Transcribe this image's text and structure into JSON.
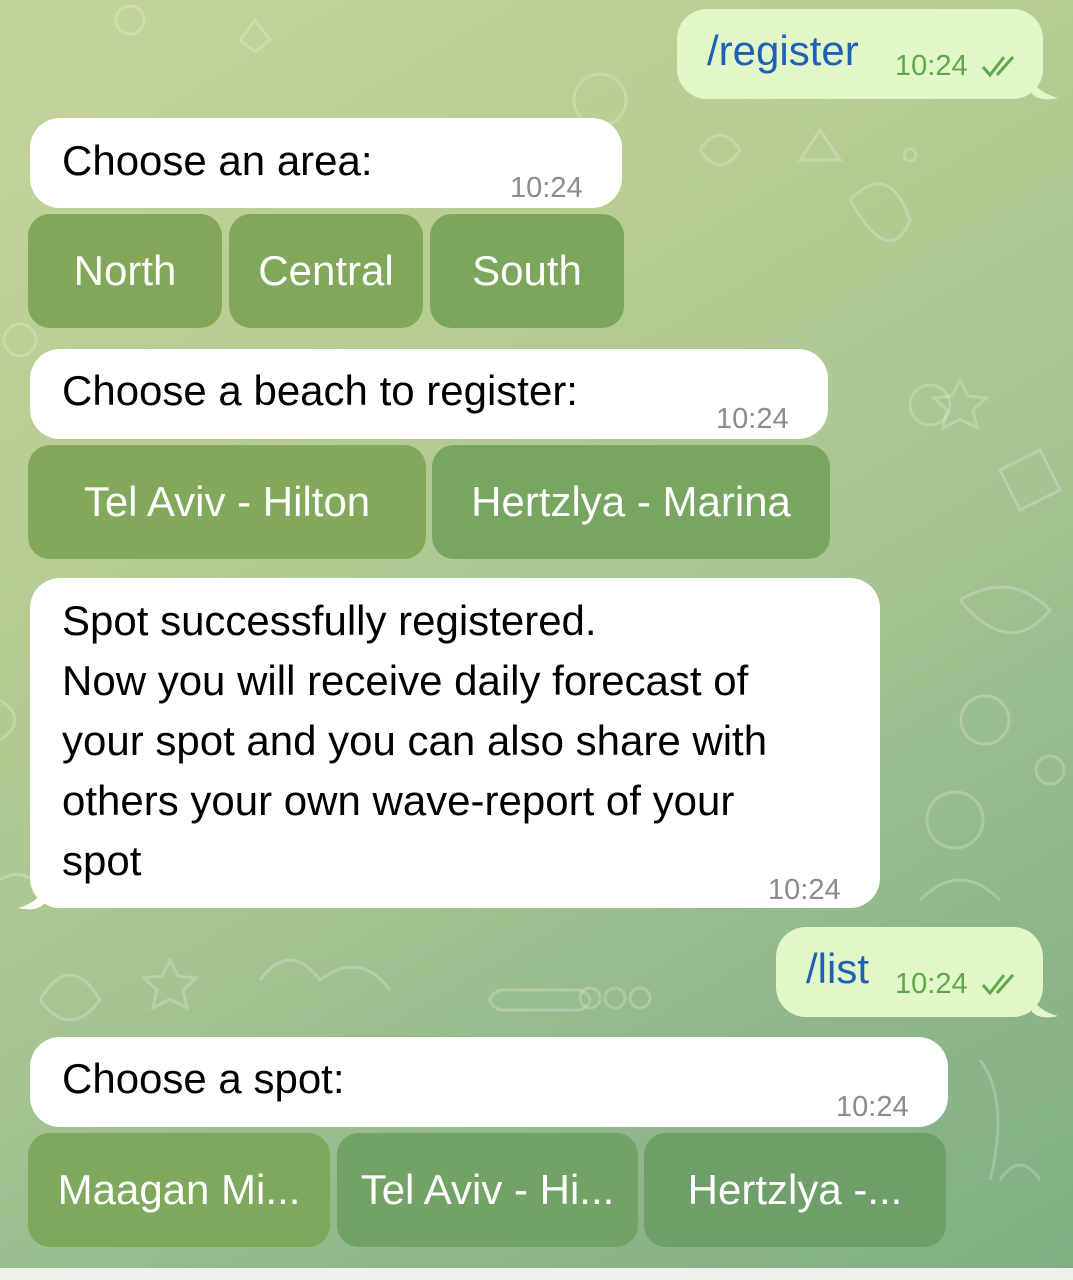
{
  "colors": {
    "incoming_bubble": "#ffffff",
    "outgoing_bubble": "#e2f7c7",
    "command_text": "#1f5fb5",
    "read_checks": "#5fa64f",
    "keyboard_button": "#80a75a"
  },
  "messages": [
    {
      "id": "m1",
      "direction": "outgoing",
      "text": "/register",
      "time": "10:24",
      "status_icon": "double-check-icon"
    },
    {
      "id": "m2",
      "direction": "incoming",
      "text": "Choose an area:",
      "time": "10:24",
      "buttons": [
        "North",
        "Central",
        "South"
      ]
    },
    {
      "id": "m3",
      "direction": "incoming",
      "text": "Choose a beach to register:",
      "time": "10:24",
      "buttons": [
        "Tel Aviv - Hilton",
        "Hertzlya - Marina"
      ]
    },
    {
      "id": "m4",
      "direction": "incoming",
      "lines": [
        "Spot successfully registered.",
        "Now you will receive daily forecast of",
        "your spot and you can also share with",
        "others your own wave-report of your",
        "spot"
      ],
      "time": "10:24"
    },
    {
      "id": "m5",
      "direction": "outgoing",
      "text": "/list",
      "time": "10:24",
      "status_icon": "double-check-icon"
    },
    {
      "id": "m6",
      "direction": "incoming",
      "text": "Choose a spot:",
      "time": "10:24",
      "buttons": [
        "Maagan Mi...",
        "Tel Aviv - Hi...",
        "Hertzlya -..."
      ]
    }
  ]
}
